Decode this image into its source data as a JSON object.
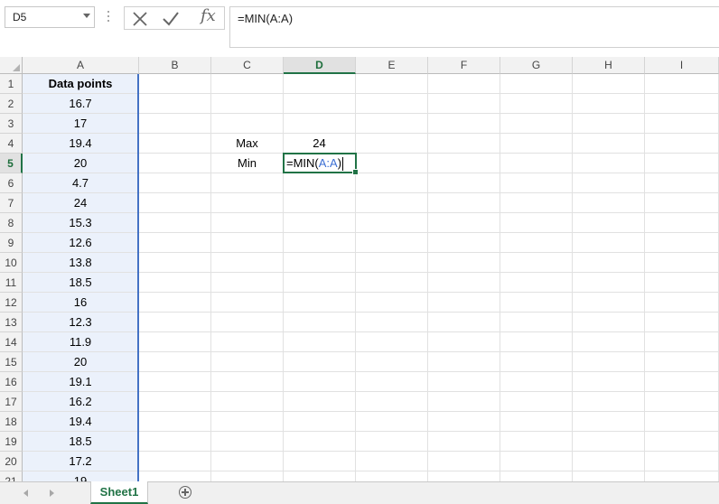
{
  "name_box": {
    "value": "D5"
  },
  "formula_bar": {
    "cancel_icon": "x-icon",
    "enter_icon": "check-icon",
    "fx_label": "fx",
    "formula": "=MIN(A:A)"
  },
  "columns": [
    "A",
    "B",
    "C",
    "D",
    "E",
    "F",
    "G",
    "H",
    "I"
  ],
  "selected_column": "D",
  "rows": [
    "1",
    "2",
    "3",
    "4",
    "5",
    "6",
    "7",
    "8",
    "9",
    "10",
    "11",
    "12",
    "13",
    "14",
    "15",
    "16",
    "17",
    "18",
    "19",
    "20",
    "21"
  ],
  "selected_row": "5",
  "colA": [
    "Data points",
    "16.7",
    "17",
    "19.4",
    "20",
    "4.7",
    "24",
    "15.3",
    "12.6",
    "13.8",
    "18.5",
    "16",
    "12.3",
    "11.9",
    "20",
    "19.1",
    "16.2",
    "19.4",
    "18.5",
    "17.2",
    "19"
  ],
  "labels": {
    "max": "Max",
    "min": "Min"
  },
  "values": {
    "max": "24"
  },
  "edit_cell": {
    "prefix": "=MIN(",
    "range": "A:A",
    "suffix": ")"
  },
  "sheet_tabs": [
    {
      "label": "Sheet1",
      "active": true
    }
  ],
  "colors": {
    "accent": "#217346",
    "range_highlight": "#4472c4",
    "col_a_fill": "#ebf1fb"
  }
}
